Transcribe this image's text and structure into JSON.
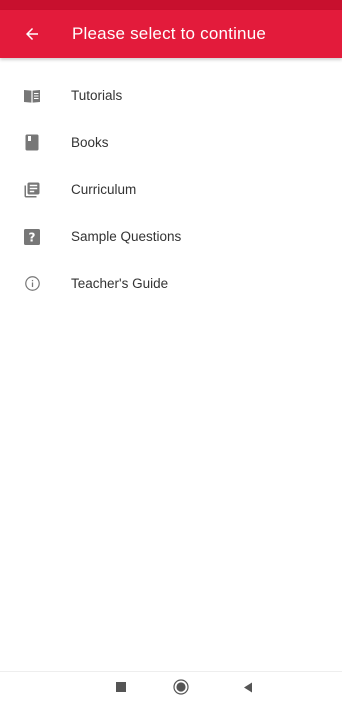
{
  "app_bar": {
    "title": "Please select to continue",
    "back_icon": "arrow-left-icon",
    "color": "#e31b3b"
  },
  "menu": {
    "items": [
      {
        "label": "Tutorials",
        "icon": "open-book-icon"
      },
      {
        "label": "Books",
        "icon": "book-icon"
      },
      {
        "label": "Curriculum",
        "icon": "library-books-icon"
      },
      {
        "label": "Sample Questions",
        "icon": "question-mark-box-icon"
      },
      {
        "label": "Teacher's Guide",
        "icon": "info-circle-icon"
      }
    ]
  },
  "nav_bar": {
    "buttons": [
      "recents-square-icon",
      "home-circle-icon",
      "back-triangle-icon"
    ]
  }
}
